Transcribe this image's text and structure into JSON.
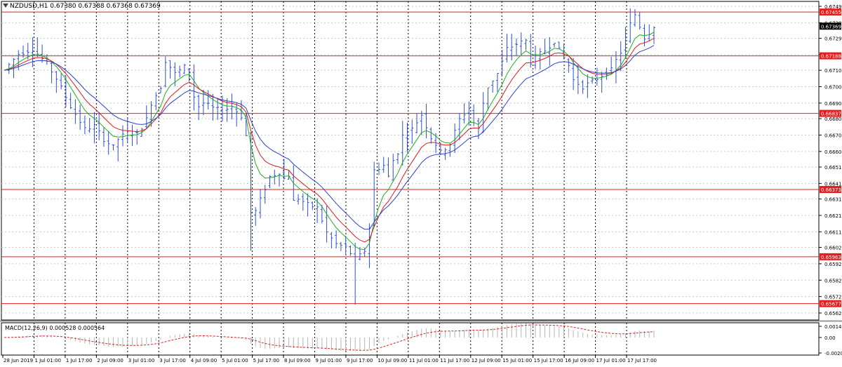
{
  "window": {
    "title": "NZDUSD,H1",
    "ohlc": "0.67380 0.67388 0.67368 0.67369"
  },
  "colors": {
    "candles": "#2b4fd6",
    "ma_fast": "#1fae1f",
    "ma_mid": "#e01818",
    "ma_slow": "#2b3fd6",
    "hline": "#e81c1c",
    "macd_signal": "#d62020",
    "macd_hist": "#b4b4b4",
    "current_price_bg": "#000000"
  },
  "chart_data": [
    {
      "type": "candlestick",
      "symbol": "NZDUSD",
      "timeframe": "H1",
      "ylim": [
        0.6562,
        0.6749
      ],
      "y_ticks": [
        "0.67490",
        "0.67390",
        "0.67295",
        "0.67195",
        "0.67100",
        "0.67000",
        "0.66900",
        "0.66805",
        "0.66705",
        "0.66605",
        "0.66510",
        "0.66410",
        "0.66315",
        "0.66215",
        "0.66115",
        "0.66020",
        "0.65920",
        "0.65820",
        "0.65720",
        "0.65620"
      ],
      "x_ticks": [
        "28 Jun 2019",
        "1 Jul 01:00",
        "1 Jul 17:00",
        "2 Jul 09:00",
        "3 Jul 01:00",
        "3 Jul 17:00",
        "4 Jul 09:00",
        "5 Jul 01:00",
        "5 Jul 17:00",
        "8 Jul 09:00",
        "9 Jul 01:00",
        "9 Jul 17:00",
        "10 Jul 09:00",
        "11 Jul 01:00",
        "11 Jul 17:00",
        "12 Jul 09:00",
        "15 Jul 01:00",
        "15 Jul 17:00",
        "16 Jul 09:00",
        "17 Jul 01:00",
        "17 Jul 17:00"
      ],
      "horizontal_levels": [
        "0.67455",
        "0.67188",
        "0.66837",
        "0.66373",
        "0.65963",
        "0.65677"
      ],
      "current_price": "0.67369",
      "close_path": [
        [
          0,
          0.671
        ],
        [
          3,
          0.672
        ],
        [
          6,
          0.6723
        ],
        [
          9,
          0.6714
        ],
        [
          11,
          0.6705
        ],
        [
          14,
          0.6688
        ],
        [
          17,
          0.6674
        ],
        [
          19,
          0.6676
        ],
        [
          21,
          0.6668
        ],
        [
          23,
          0.6663
        ],
        [
          24,
          0.6668
        ],
        [
          26,
          0.6672
        ],
        [
          28,
          0.6671
        ],
        [
          30,
          0.668
        ],
        [
          31,
          0.669
        ],
        [
          33,
          0.67
        ],
        [
          34,
          0.6716
        ],
        [
          36,
          0.6708
        ],
        [
          38,
          0.6712
        ],
        [
          39,
          0.6709
        ],
        [
          40,
          0.6694
        ],
        [
          41,
          0.6688
        ],
        [
          42,
          0.669
        ],
        [
          44,
          0.6687
        ],
        [
          46,
          0.6685
        ],
        [
          48,
          0.6688
        ],
        [
          50,
          0.6682
        ],
        [
          51,
          0.667
        ],
        [
          52,
          0.6623
        ],
        [
          53,
          0.6624
        ],
        [
          54,
          0.6631
        ],
        [
          56,
          0.6645
        ],
        [
          58,
          0.6648
        ],
        [
          59,
          0.6644
        ],
        [
          60,
          0.6646
        ],
        [
          61,
          0.663
        ],
        [
          62,
          0.6632
        ],
        [
          64,
          0.6628
        ],
        [
          66,
          0.6626
        ],
        [
          68,
          0.6611
        ],
        [
          70,
          0.6604
        ],
        [
          72,
          0.6602
        ],
        [
          74,
          0.6595
        ],
        [
          75,
          0.6597
        ],
        [
          76,
          0.66
        ],
        [
          77,
          0.6614
        ],
        [
          78,
          0.6649
        ],
        [
          80,
          0.6652
        ],
        [
          81,
          0.6645
        ],
        [
          82,
          0.6655
        ],
        [
          83,
          0.666
        ],
        [
          84,
          0.667
        ],
        [
          86,
          0.6674
        ],
        [
          88,
          0.6683
        ],
        [
          90,
          0.6669
        ],
        [
          91,
          0.6665
        ],
        [
          92,
          0.666
        ],
        [
          94,
          0.6665
        ],
        [
          96,
          0.668
        ],
        [
          98,
          0.6687
        ],
        [
          99,
          0.6678
        ],
        [
          100,
          0.6674
        ],
        [
          101,
          0.669
        ],
        [
          102,
          0.67
        ],
        [
          104,
          0.6708
        ],
        [
          105,
          0.6715
        ],
        [
          106,
          0.6723
        ],
        [
          108,
          0.6726
        ],
        [
          110,
          0.6728
        ],
        [
          111,
          0.6715
        ],
        [
          112,
          0.6718
        ],
        [
          114,
          0.6722
        ],
        [
          115,
          0.6725
        ],
        [
          116,
          0.6728
        ],
        [
          117,
          0.6722
        ],
        [
          119,
          0.6713
        ],
        [
          120,
          0.6704
        ],
        [
          122,
          0.67
        ],
        [
          124,
          0.6703
        ],
        [
          126,
          0.6707
        ],
        [
          128,
          0.671
        ],
        [
          129,
          0.6716
        ],
        [
          130,
          0.6721
        ],
        [
          132,
          0.6738
        ],
        [
          133,
          0.6744
        ],
        [
          134,
          0.6737
        ],
        [
          135,
          0.673
        ],
        [
          136,
          0.6733
        ],
        [
          137,
          0.6737
        ]
      ]
    },
    {
      "type": "line",
      "title": "MACD(12,26,9)",
      "values_label": "0.000528 0.000564",
      "ylim": [
        -0.002018,
        0.001459
      ],
      "y_ticks": [
        "0.001459",
        "0.00",
        "-0.002018"
      ]
    }
  ]
}
